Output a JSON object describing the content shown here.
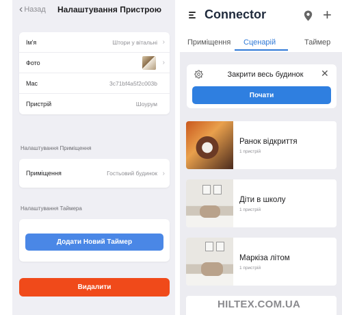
{
  "left": {
    "back_label": "Назад",
    "title": "Налаштування Пристрою",
    "device_rows": [
      {
        "label": "Ім'я",
        "value": "Штори у вітальні"
      },
      {
        "label": "Фото",
        "value": ""
      },
      {
        "label": "Mac",
        "value": "3c71bf4a5f2c003b"
      },
      {
        "label": "Пристрій",
        "value": "Шоурум"
      }
    ],
    "room_section_label": "Налаштування Приміщення",
    "room_row": {
      "label": "Приміщення",
      "value": "Гостьовий будинок"
    },
    "timer_section_label": "Налаштування Таймера",
    "add_timer_label": "Додати Новий Таймер",
    "delete_label": "Видалити"
  },
  "right": {
    "app_title": "Connector",
    "tabs": [
      "Приміщення",
      "Сценарій",
      "Таймер"
    ],
    "active_tab": "Сценарій",
    "scene_card": {
      "title": "Закрити весь будинок",
      "start_label": "Почати"
    },
    "scenarios": [
      {
        "name": "Ранок відкриття",
        "sub": "1 пристрій"
      },
      {
        "name": "Діти в школу",
        "sub": "1 пристрій"
      },
      {
        "name": "Маркіза літом",
        "sub": "1 пристрій"
      }
    ]
  },
  "watermark": "HILTEX.COM.UA",
  "colors": {
    "accent_blue": "#2f7fe0",
    "danger_red": "#f04a1a",
    "panel_bg": "#efeff4"
  }
}
